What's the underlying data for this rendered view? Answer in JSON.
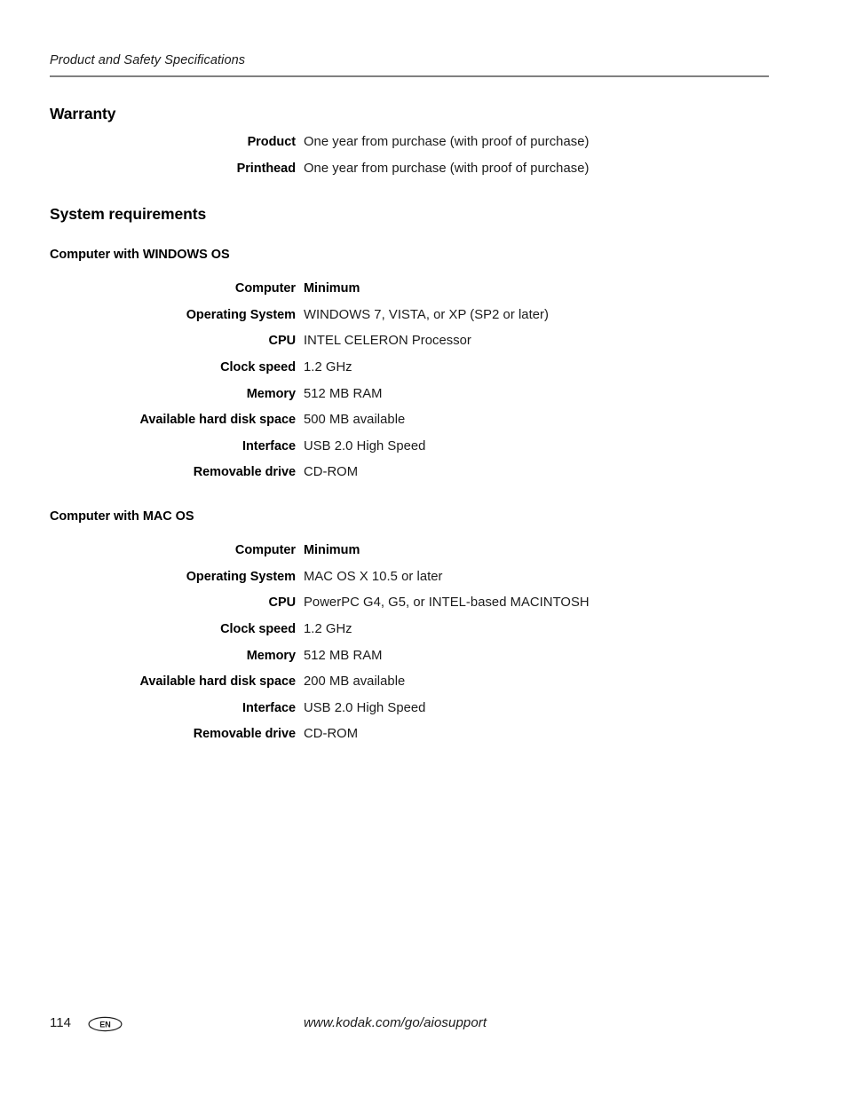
{
  "header": {
    "running_title": "Product and Safety Specifications"
  },
  "sections": {
    "warranty": {
      "heading": "Warranty",
      "rows": [
        {
          "label": "Product",
          "value": "One year from purchase (with proof of purchase)",
          "bold": false
        },
        {
          "label": "Printhead",
          "value": "One year from purchase (with proof of purchase)",
          "bold": false
        }
      ]
    },
    "system_requirements": {
      "heading": "System requirements",
      "windows": {
        "heading": "Computer with WINDOWS OS",
        "rows": [
          {
            "label": "Computer",
            "value": "Minimum",
            "bold": true
          },
          {
            "label": "Operating System",
            "value": "WINDOWS 7, VISTA, or XP (SP2 or later)",
            "bold": false
          },
          {
            "label": "CPU",
            "value": "INTEL CELERON Processor",
            "bold": false
          },
          {
            "label": "Clock speed",
            "value": "1.2 GHz",
            "bold": false
          },
          {
            "label": "Memory",
            "value": "512 MB RAM",
            "bold": false
          },
          {
            "label": "Available hard disk space",
            "value": "500 MB available",
            "bold": false
          },
          {
            "label": "Interface",
            "value": "USB 2.0 High Speed",
            "bold": false
          },
          {
            "label": "Removable drive",
            "value": "CD-ROM",
            "bold": false
          }
        ]
      },
      "mac": {
        "heading": "Computer with MAC OS",
        "rows": [
          {
            "label": "Computer",
            "value": "Minimum",
            "bold": true
          },
          {
            "label": "Operating System",
            "value": "MAC OS X 10.5 or later",
            "bold": false
          },
          {
            "label": "CPU",
            "value": "PowerPC G4, G5, or INTEL-based MACINTOSH",
            "bold": false
          },
          {
            "label": "Clock speed",
            "value": "1.2 GHz",
            "bold": false
          },
          {
            "label": "Memory",
            "value": "512 MB RAM",
            "bold": false
          },
          {
            "label": "Available hard disk space",
            "value": "200 MB available",
            "bold": false
          },
          {
            "label": "Interface",
            "value": "USB 2.0 High Speed",
            "bold": false
          },
          {
            "label": "Removable drive",
            "value": "CD-ROM",
            "bold": false
          }
        ]
      }
    }
  },
  "footer": {
    "page_number": "114",
    "language_code": "EN",
    "url": "www.kodak.com/go/aiosupport"
  },
  "colors": {
    "text": "#1a1a1a",
    "heading": "#000000",
    "rule": "#808080",
    "background": "#ffffff"
  }
}
